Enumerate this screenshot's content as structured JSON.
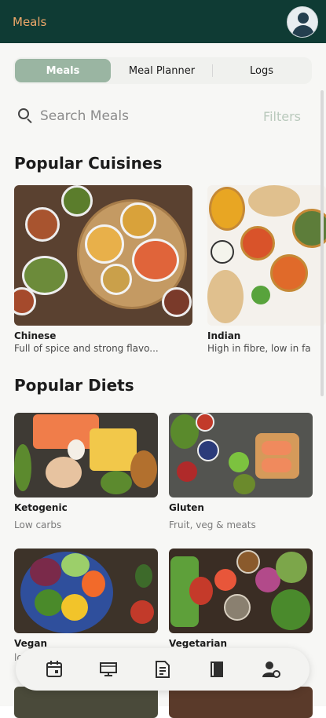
{
  "appbar": {
    "title": "Meals"
  },
  "tabs": [
    {
      "label": "Meals",
      "active": true
    },
    {
      "label": "Meal Planner",
      "active": false
    },
    {
      "label": "Logs",
      "active": false
    }
  ],
  "search": {
    "placeholder": "Search Meals",
    "filters_label": "Filters"
  },
  "cuisines": {
    "title": "Popular Cuisines",
    "items": [
      {
        "name": "Chinese",
        "desc": "Full of spice and strong flavo..."
      },
      {
        "name": "Indian",
        "desc": "High in fibre, low in fa"
      }
    ]
  },
  "diets": {
    "title": "Popular Diets",
    "items": [
      {
        "name": "Ketogenic",
        "desc": "Low carbs"
      },
      {
        "name": "Gluten",
        "desc": "Fruit, veg & meats"
      },
      {
        "name": "Vegan",
        "desc": "lo"
      },
      {
        "name": "Vegetarian",
        "desc": ""
      }
    ]
  },
  "colors": {
    "appbar": "#0f3b34",
    "title": "#f0a86a",
    "active_tab": "#9ab5a2",
    "filters": "#b9c9bc"
  },
  "nav": [
    "calendar-icon",
    "monitor-icon",
    "document-icon",
    "book-icon",
    "user-settings-icon"
  ]
}
